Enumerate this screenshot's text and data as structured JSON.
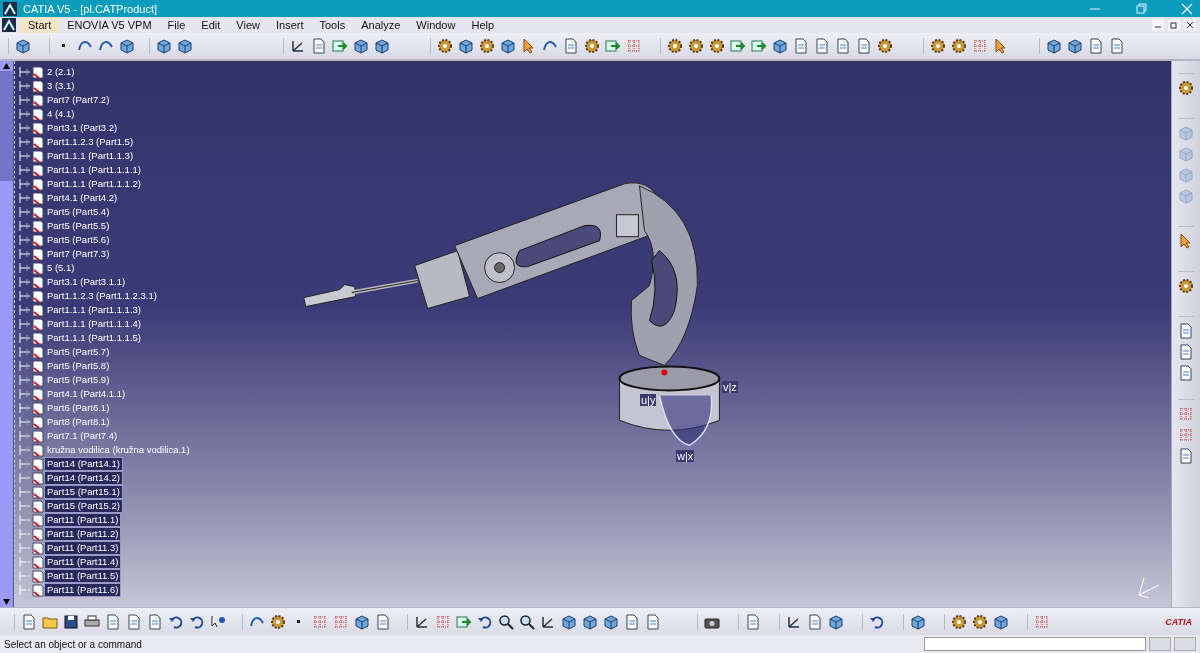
{
  "window": {
    "title": "CATIA V5 - [pl.CATProduct]"
  },
  "menu": [
    {
      "label": "Start",
      "selected": true
    },
    {
      "label": "ENOVIA V5 VPM",
      "selected": false
    },
    {
      "label": "File",
      "selected": false
    },
    {
      "label": "Edit",
      "selected": false
    },
    {
      "label": "View",
      "selected": false
    },
    {
      "label": "Insert",
      "selected": false
    },
    {
      "label": "Tools",
      "selected": false
    },
    {
      "label": "Analyze",
      "selected": false
    },
    {
      "label": "Window",
      "selected": false
    },
    {
      "label": "Help",
      "selected": false
    }
  ],
  "tree": {
    "items": [
      {
        "label": "2 (2.1)",
        "selected": false
      },
      {
        "label": "3 (3.1)",
        "selected": false
      },
      {
        "label": "Part7 (Part7.2)",
        "selected": false
      },
      {
        "label": "4 (4.1)",
        "selected": false
      },
      {
        "label": "Part3.1 (Part3.2)",
        "selected": false
      },
      {
        "label": "Part1.1.2.3 (Part1.5)",
        "selected": false
      },
      {
        "label": "Part1.1.1 (Part1.1.3)",
        "selected": false
      },
      {
        "label": "Part1.1.1 (Part1.1.1.1)",
        "selected": false
      },
      {
        "label": "Part1.1.1 (Part1.1.1.2)",
        "selected": false
      },
      {
        "label": "Part4.1 (Part4.2)",
        "selected": false
      },
      {
        "label": "Part5 (Part5.4)",
        "selected": false
      },
      {
        "label": "Part5 (Part5.5)",
        "selected": false
      },
      {
        "label": "Part5 (Part5.6)",
        "selected": false
      },
      {
        "label": "Part7 (Part7.3)",
        "selected": false
      },
      {
        "label": "5 (5.1)",
        "selected": false
      },
      {
        "label": "Part3.1 (Part3.1.1)",
        "selected": false
      },
      {
        "label": "Part1.1.2.3 (Part1.1.2.3.1)",
        "selected": false
      },
      {
        "label": "Part1.1.1 (Part1.1.1.3)",
        "selected": false
      },
      {
        "label": "Part1.1.1 (Part1.1.1.4)",
        "selected": false
      },
      {
        "label": "Part1.1.1 (Part1.1.1.5)",
        "selected": false
      },
      {
        "label": "Part5 (Part5.7)",
        "selected": false
      },
      {
        "label": "Part5 (Part5.8)",
        "selected": false
      },
      {
        "label": "Part5 (Part5.9)",
        "selected": false
      },
      {
        "label": "Part4.1 (Part4.1.1)",
        "selected": false
      },
      {
        "label": "Part6 (Part6.1)",
        "selected": false
      },
      {
        "label": "Part8 (Part8.1)",
        "selected": false
      },
      {
        "label": "Part7.1 (Part7.4)",
        "selected": false
      },
      {
        "label": "kružna vodilica (kružna vodilica.1)",
        "selected": false
      },
      {
        "label": "Part14 (Part14.1)",
        "selected": true
      },
      {
        "label": "Part14 (Part14.2)",
        "selected": true
      },
      {
        "label": "Part15 (Part15.1)",
        "selected": true
      },
      {
        "label": "Part15 (Part15.2)",
        "selected": true
      },
      {
        "label": "Part11 (Part11.1)",
        "selected": true
      },
      {
        "label": "Part11 (Part11.2)",
        "selected": true
      },
      {
        "label": "Part11 (Part11.3)",
        "selected": true
      },
      {
        "label": "Part11 (Part11.4)",
        "selected": true
      },
      {
        "label": "Part11 (Part11.5)",
        "selected": true
      },
      {
        "label": "Part11 (Part11.6)",
        "selected": true
      }
    ]
  },
  "compass": {
    "labels": [
      "u|y",
      "v|z",
      "w|x"
    ]
  },
  "logo": {
    "text": "CATIA"
  },
  "status_bar": {
    "message": "Select an object or a command"
  }
}
